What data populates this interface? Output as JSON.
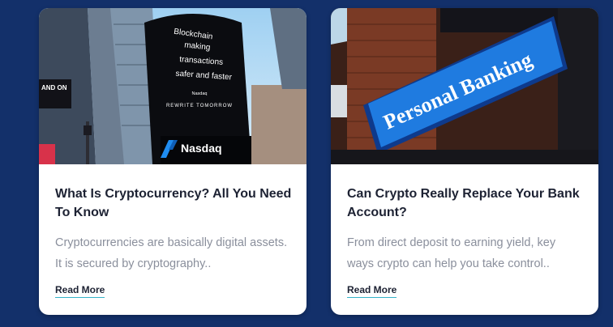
{
  "cards": [
    {
      "title": "What Is Cryptocurrency? All You Need To Know",
      "excerpt": "Cryptocurrencies are basically digital assets. It is secured by cryptography..",
      "read_more": "Read More",
      "image": {
        "icon": "nasdaq-tower-photo",
        "screen_lines": [
          "Blockchain",
          "making",
          "transactions",
          "safer and faster"
        ],
        "sub_brand": "Nasdaq",
        "tagline": "REWRITE TOMORROW",
        "brand": "Nasdaq",
        "side_sign": "AND ON"
      }
    },
    {
      "title": "Can Crypto Really Replace Your Bank Account?",
      "excerpt": "From direct deposit to earning yield, key ways crypto can help you take control..",
      "read_more": "Read More",
      "image": {
        "icon": "personal-banking-sign-photo",
        "sign_text": "Personal Banking"
      }
    }
  ],
  "colors": {
    "background": "#13306a",
    "card": "#ffffff",
    "title": "#1d2233",
    "excerpt": "#8a8f9c",
    "underline": "#34b3c9"
  }
}
